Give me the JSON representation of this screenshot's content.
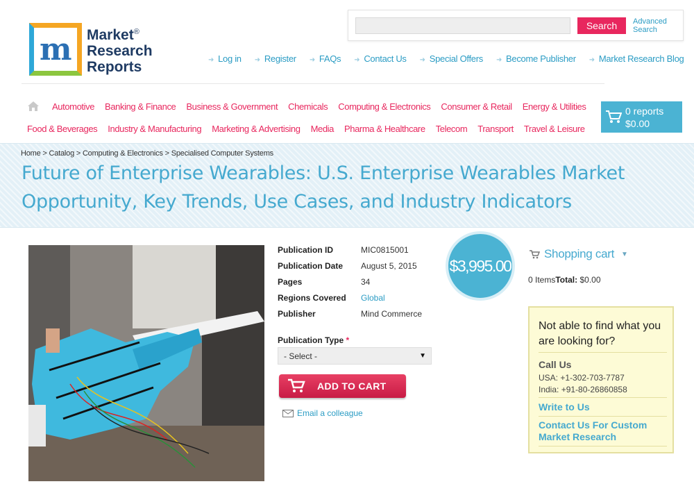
{
  "logo": {
    "line1": "Market",
    "line2": "Research",
    "line3": "Reports",
    "mark": "m",
    "reg": "®"
  },
  "search": {
    "placeholder": "",
    "button": "Search",
    "advanced_line1": "Advanced",
    "advanced_line2": "Search"
  },
  "top_links": [
    "Log in",
    "Register",
    "FAQs",
    "Contact Us",
    "Special Offers",
    "Become Publisher",
    "Market Research Blog"
  ],
  "categories_row1": [
    "Automotive",
    "Banking & Finance",
    "Business & Government",
    "Chemicals",
    "Computing & Electronics",
    "Consumer & Retail",
    "Energy & Utilities"
  ],
  "categories_row2": [
    "Food & Beverages",
    "Industry & Manufacturing",
    "Marketing & Advertising",
    "Media",
    "Pharma & Healthcare",
    "Telecom",
    "Transport",
    "Travel & Leisure"
  ],
  "cart_header": {
    "reports": "0 reports",
    "total": "$0.00"
  },
  "breadcrumb": [
    "Home",
    "Catalog",
    "Computing & Electronics",
    "Specialised Computer Systems"
  ],
  "title": "Future of Enterprise Wearables: U.S. Enterprise Wearables Market Opportunity, Key Trends, Use Cases, and Industry Indicators",
  "details": [
    {
      "label": "Publication ID",
      "value": "MIC0815001"
    },
    {
      "label": "Publication Date",
      "value": "August 5, 2015"
    },
    {
      "label": "Pages",
      "value": "34"
    },
    {
      "label": "Regions Covered",
      "value": "Global"
    },
    {
      "label": "Publisher",
      "value": "Mind Commerce"
    }
  ],
  "price": "$3,995.00",
  "publication_type": {
    "label": "Publication Type",
    "required": "*",
    "selected": "- Select -"
  },
  "add_to_cart": "ADD TO CART",
  "email_colleague": "Email a colleague",
  "shopping_cart": {
    "title": "Shopping cart",
    "items": "0 Items",
    "total_label": "Total:",
    "total": " $0.00"
  },
  "help": {
    "question": "Not able to find what you are looking for?",
    "call_us": "Call Us",
    "usa": "USA: +1-302-703-7787",
    "india": "India: +91-80-26860858",
    "write": "Write to Us",
    "custom": "Contact Us For Custom Market Research"
  },
  "colors": {
    "accent_blue": "#45a9cf",
    "accent_pink": "#e8275e",
    "cart_blue": "#4bb3d3",
    "help_bg": "#fdfbd6"
  }
}
